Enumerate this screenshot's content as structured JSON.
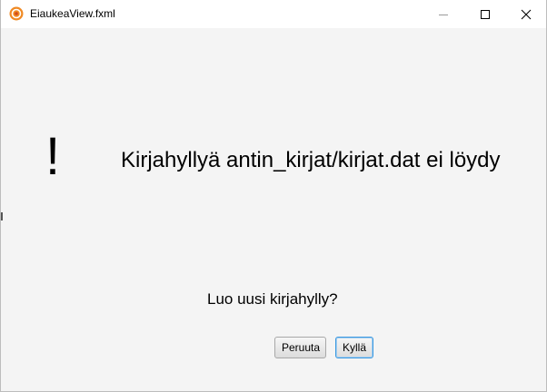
{
  "window": {
    "title": "EiaukeaView.fxml",
    "app_icon": "app-logo-icon",
    "controls": {
      "minimize": "minimize-icon",
      "maximize": "maximize-icon",
      "close": "close-icon"
    }
  },
  "dialog": {
    "icon_glyph": "!",
    "message": "Kirjahyllyä antin_kirjat/kirjat.dat ei löydy",
    "question": "Luo uusi kirjahylly?",
    "cancel_label": "Peruuta",
    "confirm_label": "Kyllä"
  },
  "colors": {
    "background": "#f4f4f4",
    "titlebar": "#ffffff",
    "focus_border": "#3b99e0",
    "app_icon_orange": "#f08a24"
  }
}
